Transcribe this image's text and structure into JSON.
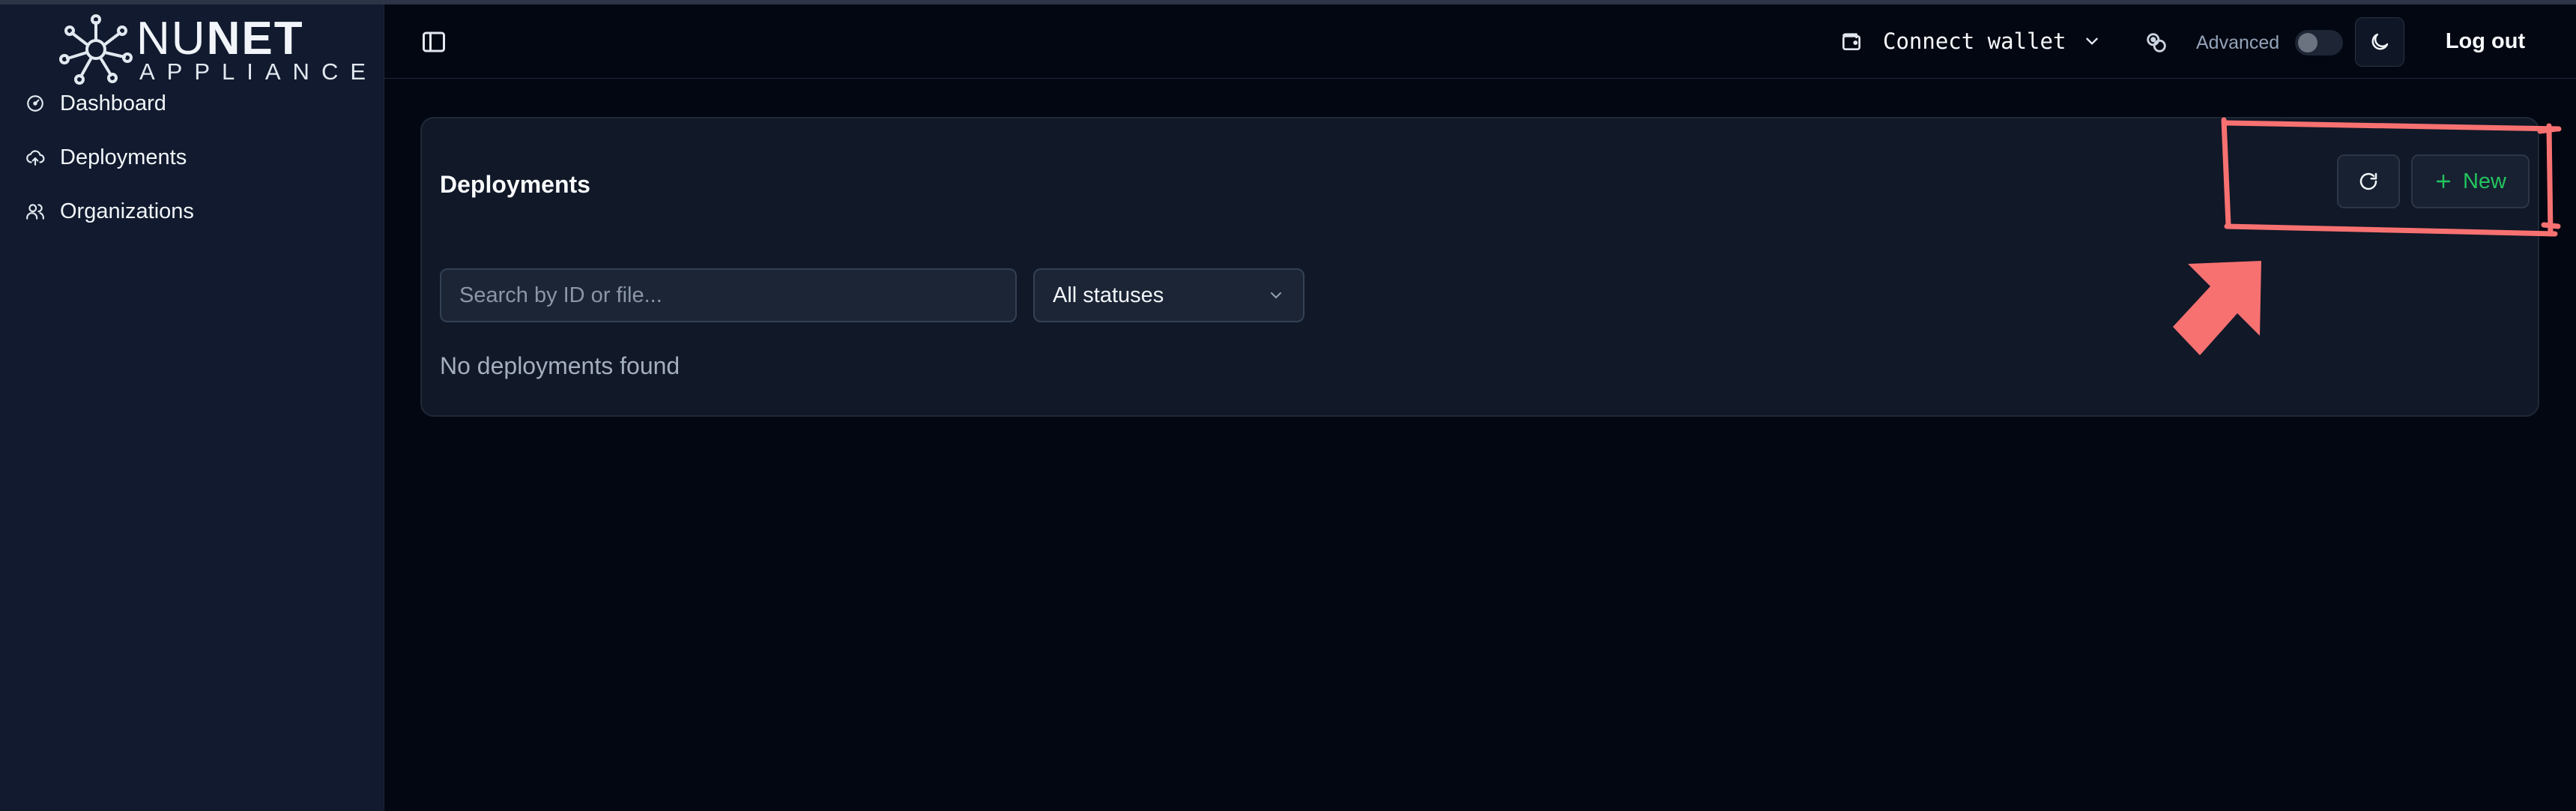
{
  "brand": {
    "name_light": "NU",
    "name_bold": "NET",
    "subtitle": "APPLIANCE"
  },
  "sidebar": {
    "items": [
      {
        "label": "Dashboard",
        "icon": "gauge-icon"
      },
      {
        "label": "Deployments",
        "icon": "cloud-upload-icon"
      },
      {
        "label": "Organizations",
        "icon": "users-icon"
      }
    ]
  },
  "header": {
    "wallet_label": "Connect wallet",
    "advanced_label": "Advanced",
    "advanced_enabled": false,
    "logout_label": "Log out"
  },
  "deployments": {
    "title": "Deployments",
    "new_label": "New",
    "search_placeholder": "Search by ID or file...",
    "status_filter": "All statuses",
    "empty_message": "No deployments found"
  },
  "colors": {
    "accent_green": "#22c55e",
    "annotation_red": "#f87171",
    "sidebar_bg": "#111a2e",
    "main_bg": "#030712"
  }
}
